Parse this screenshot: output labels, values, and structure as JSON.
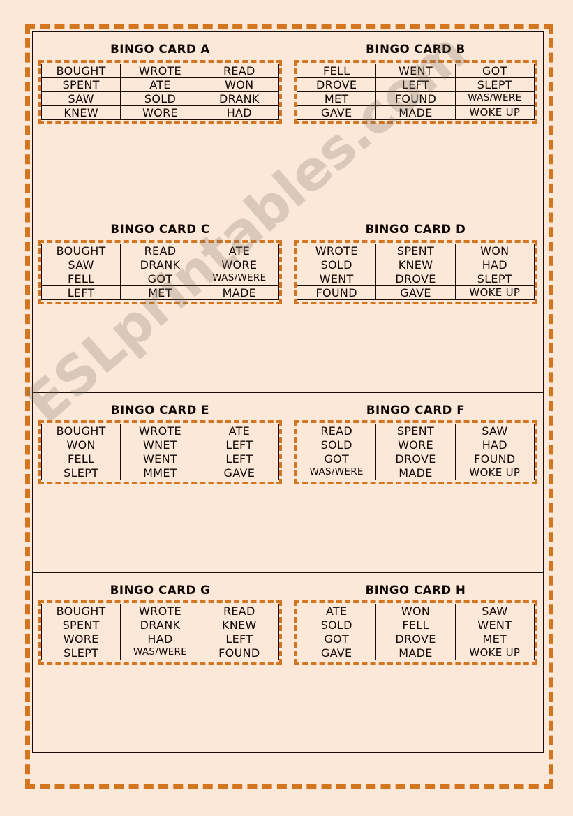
{
  "colors": {
    "page_background": "#FCE8D8",
    "dashed_border": "#D4761F",
    "table_border": "#1A0D05",
    "text": "#100704",
    "watermark": "#787064"
  },
  "watermark": {
    "text": "ESLprintables.com"
  },
  "cards": [
    {
      "title": "BINGO CARD A",
      "rows": [
        [
          "BOUGHT",
          "WROTE",
          "READ"
        ],
        [
          "SPENT",
          "ATE",
          "WON"
        ],
        [
          "SAW",
          "SOLD",
          "DRANK"
        ],
        [
          "KNEW",
          "WORE",
          "HAD"
        ]
      ]
    },
    {
      "title": "BINGO CARD B",
      "rows": [
        [
          "FELL",
          "WENT",
          "GOT"
        ],
        [
          "DROVE",
          "LEFT",
          "SLEPT"
        ],
        [
          "MET",
          "FOUND",
          "WAS/WERE"
        ],
        [
          "GAVE",
          "MADE",
          "WOKE UP"
        ]
      ]
    },
    {
      "title": "BINGO CARD C",
      "rows": [
        [
          "BOUGHT",
          "READ",
          "ATE"
        ],
        [
          "SAW",
          "DRANK",
          "WORE"
        ],
        [
          "FELL",
          "GOT",
          "WAS/WERE"
        ],
        [
          "LEFT",
          "MET",
          "MADE"
        ]
      ]
    },
    {
      "title": "BINGO CARD D",
      "rows": [
        [
          "WROTE",
          "SPENT",
          "WON"
        ],
        [
          "SOLD",
          "KNEW",
          "HAD"
        ],
        [
          "WENT",
          "DROVE",
          "SLEPT"
        ],
        [
          "FOUND",
          "GAVE",
          "WOKE UP"
        ]
      ]
    },
    {
      "title": "BINGO CARD E",
      "rows": [
        [
          "BOUGHT",
          "WROTE",
          "ATE"
        ],
        [
          "WON",
          "WNET",
          "LEFT"
        ],
        [
          "FELL",
          "WENT",
          "LEFT"
        ],
        [
          "SLEPT",
          "MMET",
          "GAVE"
        ]
      ]
    },
    {
      "title": "BINGO CARD F",
      "rows": [
        [
          "READ",
          "SPENT",
          "SAW"
        ],
        [
          "SOLD",
          "WORE",
          "HAD"
        ],
        [
          "GOT",
          "DROVE",
          "FOUND"
        ],
        [
          "WAS/WERE",
          "MADE",
          "WOKE UP"
        ]
      ]
    },
    {
      "title": "BINGO CARD G",
      "rows": [
        [
          "BOUGHT",
          "WROTE",
          "READ"
        ],
        [
          "SPENT",
          "DRANK",
          "KNEW"
        ],
        [
          "WORE",
          "HAD",
          "LEFT"
        ],
        [
          "SLEPT",
          "WAS/WERE",
          "FOUND"
        ]
      ]
    },
    {
      "title": "BINGO CARD H",
      "rows": [
        [
          "ATE",
          "WON",
          "SAW"
        ],
        [
          "SOLD",
          "FELL",
          "WENT"
        ],
        [
          "GOT",
          "DROVE",
          "MET"
        ],
        [
          "GAVE",
          "MADE",
          "WOKE UP"
        ]
      ]
    }
  ]
}
